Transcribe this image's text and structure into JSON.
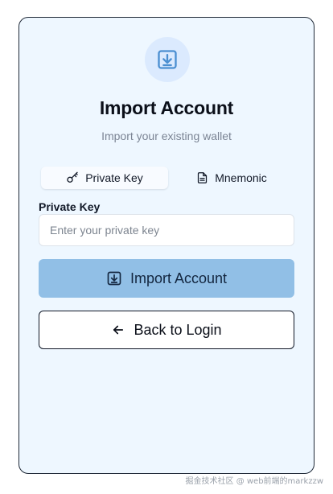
{
  "header": {
    "title": "Import Account",
    "subtitle": "Import your existing wallet",
    "icon": "download-icon"
  },
  "tabs": [
    {
      "label": "Private Key",
      "icon": "key-icon",
      "active": true
    },
    {
      "label": "Mnemonic",
      "icon": "document-icon",
      "active": false
    }
  ],
  "form": {
    "field_label": "Private Key",
    "input_value": "",
    "input_placeholder": "Enter your private key"
  },
  "actions": {
    "import_label": "Import Account",
    "import_icon": "download-icon",
    "back_label": "Back to Login",
    "back_icon": "arrow-left-icon"
  },
  "watermark": "掘金技术社区 @ web前端的markzzw",
  "colors": {
    "card_bg": "#eef7ff",
    "accent": "#91bfe6",
    "icon_blue": "#4b8fd1",
    "icon_circle": "#dbeafe"
  }
}
